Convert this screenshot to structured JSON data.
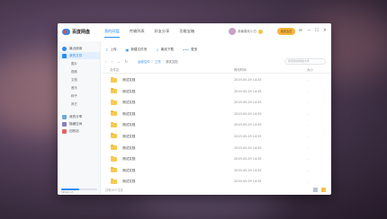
{
  "app": {
    "name": "百度网盘",
    "tabs": [
      "我的网盘",
      "传输列表",
      "好友分享",
      "功能宝箱"
    ],
    "user_name": "我最喜欢小白",
    "member_button": "续费会员"
  },
  "sidebar": {
    "items": [
      {
        "label": "最近使用",
        "color": "#2d8cf0"
      },
      {
        "label": "我的文件",
        "color": "#2d8cf0"
      }
    ],
    "sub_items": [
      "图片",
      "视频",
      "文档",
      "音乐",
      "种子",
      "其它"
    ],
    "bottom_items": [
      {
        "label": "我的分享",
        "color": "#6fa8dc"
      },
      {
        "label": "隐藏空间",
        "color": "#8e7cc3"
      },
      {
        "label": "回收站",
        "color": "#e06666"
      }
    ],
    "storage_text": "565G/1.1T",
    "storage_fraction": 0.5
  },
  "toolbar": {
    "upload": "上传",
    "new_folder": "新建文件夹",
    "offline_download": "离线下载",
    "more": "更多"
  },
  "path": {
    "crumbs": [
      "全部文件",
      "工作",
      "测试文档"
    ],
    "search_placeholder": "搜索我的网盘文件"
  },
  "table": {
    "headers": {
      "name": "文件名",
      "date": "修改时间",
      "size": "大小"
    },
    "rows": [
      {
        "name": "测试文档",
        "date": "2019-05-29 14:35",
        "size": "-"
      },
      {
        "name": "测试文档",
        "date": "2019-05-29 14:35",
        "size": "-"
      },
      {
        "name": "测试文档",
        "date": "2019-05-29 14:35",
        "size": "-"
      },
      {
        "name": "测试文档",
        "date": "2019-05-29 14:35",
        "size": "-"
      },
      {
        "name": "测试文档",
        "date": "2019-05-29 14:35",
        "size": "-"
      },
      {
        "name": "测试文档",
        "date": "2019-05-29 14:35",
        "size": "-"
      },
      {
        "name": "测试文档",
        "date": "2019-05-29 14:35",
        "size": "-"
      },
      {
        "name": "测试文档",
        "date": "2019-05-29 14:35",
        "size": "-"
      },
      {
        "name": "测试文档",
        "date": "2019-05-29 14:35",
        "size": "-"
      },
      {
        "name": "测试文档",
        "date": "2019-05-29 14:35",
        "size": "-"
      }
    ]
  },
  "status": {
    "text": "共有10个文件"
  },
  "colors": {
    "accent": "#2d8cf0",
    "folder": "#f7c94e",
    "member": "#f6b43c"
  }
}
